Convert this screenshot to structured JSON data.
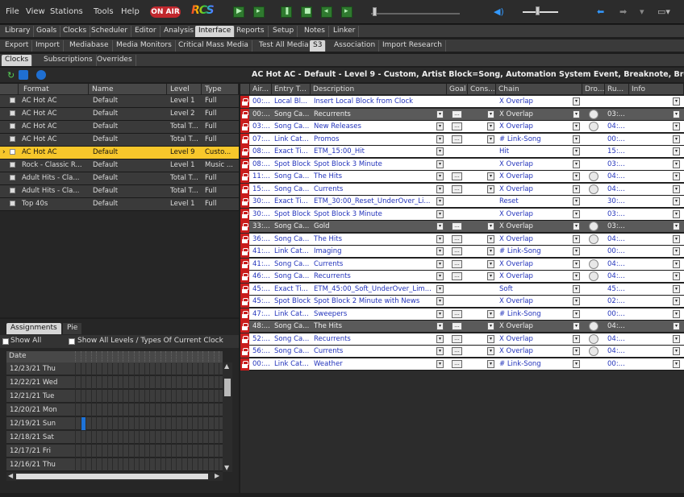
{
  "menu": {
    "items": [
      "File",
      "View",
      "Stations",
      "Tools",
      "Help"
    ],
    "on_air": "ON AIR",
    "logo": "RCS"
  },
  "tabs_row1": [
    "Library",
    "Goals",
    "Clocks",
    "Scheduler",
    "Editor",
    "Analysis",
    "Interface",
    "Reports",
    "Setup",
    "Notes",
    "Linker"
  ],
  "tabs_row1_active": "Interface",
  "tabs_row2": [
    "Export",
    "Import",
    "Mediabase",
    "Media Monitors",
    "Critical Mass Media",
    "Test All Media",
    "S3",
    "Association",
    "Import Research"
  ],
  "tabs_row2_active": "S3",
  "tabs_row3": [
    "Clocks",
    "Subscriptions",
    "Overrides"
  ],
  "tabs_row3_active": "Clocks",
  "clock_title": "AC Hot AC - Default - Level 9 - Custom, Artist Block=Song, Automation System Event, Breaknote, Browse List=Song, Contro",
  "left_grid": {
    "headers": [
      "Format",
      "Name",
      "Level",
      "Type"
    ],
    "rows": [
      {
        "format": "AC Hot AC",
        "name": "Default",
        "level": "Level 1",
        "type": "Full",
        "selected": false
      },
      {
        "format": "AC Hot AC",
        "name": "Default",
        "level": "Level 2",
        "type": "Full",
        "selected": false
      },
      {
        "format": "AC Hot AC",
        "name": "Default",
        "level": "Total T...",
        "type": "Full",
        "selected": false
      },
      {
        "format": "AC Hot AC",
        "name": "Default",
        "level": "Total T...",
        "type": "Full",
        "selected": false
      },
      {
        "format": "AC Hot AC",
        "name": "Default",
        "level": "Level 9",
        "type": "Custo...",
        "selected": true
      },
      {
        "format": "Rock - Classic R...",
        "name": "Default",
        "level": "Level 1",
        "type": "Music ...",
        "selected": false
      },
      {
        "format": "Adult Hits - Cla...",
        "name": "Default",
        "level": "Total T...",
        "type": "Full",
        "selected": false
      },
      {
        "format": "Adult Hits - Cla...",
        "name": "Default",
        "level": "Total T...",
        "type": "Full",
        "selected": false
      },
      {
        "format": "Top 40s",
        "name": "Default",
        "level": "Level 1",
        "type": "Full",
        "selected": false
      }
    ]
  },
  "right_grid": {
    "headers": [
      "Air...",
      "Entry T...",
      "Description",
      "Goal",
      "Cons...",
      "Chain",
      "Dro...",
      "Ru...",
      "Info"
    ],
    "rows": [
      {
        "air": "00:...",
        "entry": "Local Bl...",
        "desc": "Insert Local Block from Clock",
        "chain": "X Overlap",
        "run": "",
        "dark": false,
        "dd": false,
        "goal": false,
        "circle": false
      },
      {
        "air": "00:...",
        "entry": "Song Ca...",
        "desc": "Recurrents",
        "chain": "X Overlap",
        "run": "03:...",
        "dark": true,
        "dd": true,
        "goal": true,
        "circle": true
      },
      {
        "air": "03:...",
        "entry": "Song Ca...",
        "desc": "New Releases",
        "chain": "X Overlap",
        "run": "04:...",
        "dark": false,
        "dd": true,
        "goal": true,
        "circle": true
      },
      {
        "air": "07:...",
        "entry": "Link Cat...",
        "desc": "Promos",
        "chain": "# Link-Song",
        "run": "00:...",
        "dark": false,
        "dd": true,
        "goal": true,
        "circle": false
      },
      {
        "air": "08:...",
        "entry": "Exact Ti...",
        "desc": "ETM_15:00_Hit",
        "chain": "Hit",
        "run": "15:...",
        "dark": false,
        "dd": true,
        "goal": false,
        "circle": false
      },
      {
        "air": "08:...",
        "entry": "Spot Block",
        "desc": "Spot Block 3 Minute",
        "chain": "X Overlap",
        "run": "03:...",
        "dark": false,
        "dd": true,
        "goal": false,
        "circle": false
      },
      {
        "air": "11:...",
        "entry": "Song Ca...",
        "desc": "The Hits",
        "chain": "X Overlap",
        "run": "04:...",
        "dark": false,
        "dd": true,
        "goal": true,
        "circle": true
      },
      {
        "air": "15:...",
        "entry": "Song Ca...",
        "desc": "Currents",
        "chain": "X Overlap",
        "run": "04:...",
        "dark": false,
        "dd": true,
        "goal": true,
        "circle": true
      },
      {
        "air": "30:...",
        "entry": "Exact Ti...",
        "desc": "ETM_30:00_Reset_UnderOver_Li...",
        "chain": "Reset",
        "run": "30:...",
        "dark": false,
        "dd": true,
        "goal": false,
        "circle": false
      },
      {
        "air": "30:...",
        "entry": "Spot Block",
        "desc": "Spot Block 3 Minute",
        "chain": "X Overlap",
        "run": "03:...",
        "dark": false,
        "dd": true,
        "goal": false,
        "circle": false
      },
      {
        "air": "33:...",
        "entry": "Song Ca...",
        "desc": "Gold",
        "chain": "X Overlap",
        "run": "03:...",
        "dark": true,
        "dd": true,
        "goal": true,
        "circle": true
      },
      {
        "air": "36:...",
        "entry": "Song Ca...",
        "desc": "The Hits",
        "chain": "X Overlap",
        "run": "04:...",
        "dark": false,
        "dd": true,
        "goal": true,
        "circle": true
      },
      {
        "air": "41:...",
        "entry": "Link Cat...",
        "desc": "Imaging",
        "chain": "# Link-Song",
        "run": "00:...",
        "dark": false,
        "dd": true,
        "goal": true,
        "circle": false
      },
      {
        "air": "41:...",
        "entry": "Song Ca...",
        "desc": "Currents",
        "chain": "X Overlap",
        "run": "04:...",
        "dark": false,
        "dd": true,
        "goal": true,
        "circle": true
      },
      {
        "air": "46:...",
        "entry": "Song Ca...",
        "desc": "Recurrents",
        "chain": "X Overlap",
        "run": "04:...",
        "dark": false,
        "dd": true,
        "goal": true,
        "circle": true
      },
      {
        "air": "45:...",
        "entry": "Exact Ti...",
        "desc": "ETM_45:00_Soft_UnderOver_Lim...",
        "chain": "Soft",
        "run": "45:...",
        "dark": false,
        "dd": true,
        "goal": false,
        "circle": false
      },
      {
        "air": "45:...",
        "entry": "Spot Block",
        "desc": "Spot Block 2 Minute with News",
        "chain": "X Overlap",
        "run": "02:...",
        "dark": false,
        "dd": true,
        "goal": false,
        "circle": false
      },
      {
        "air": "47:...",
        "entry": "Link Cat...",
        "desc": "Sweepers",
        "chain": "# Link-Song",
        "run": "00:...",
        "dark": false,
        "dd": true,
        "goal": true,
        "circle": false
      },
      {
        "air": "48:...",
        "entry": "Song Ca...",
        "desc": "The Hits",
        "chain": "X Overlap",
        "run": "04:...",
        "dark": true,
        "dd": true,
        "goal": true,
        "circle": true
      },
      {
        "air": "52:...",
        "entry": "Song Ca...",
        "desc": "Recurrents",
        "chain": "X Overlap",
        "run": "04:...",
        "dark": false,
        "dd": true,
        "goal": true,
        "circle": true
      },
      {
        "air": "56:...",
        "entry": "Song Ca...",
        "desc": "Currents",
        "chain": "X Overlap",
        "run": "04:...",
        "dark": false,
        "dd": true,
        "goal": true,
        "circle": true
      },
      {
        "air": "00:...",
        "entry": "Link Cat...",
        "desc": "Weather",
        "chain": "# Link-Song",
        "run": "00:...",
        "dark": false,
        "dd": true,
        "goal": true,
        "circle": false
      }
    ]
  },
  "assignments": {
    "tabs": [
      "Assignments",
      "Pie"
    ],
    "show_all": "Show All",
    "show_all_levels": "Show All Levels / Types Of Current Clock",
    "date_header": "Date",
    "dates": [
      "12/23/21 Thu",
      "12/22/21 Wed",
      "12/21/21 Tue",
      "12/20/21 Mon",
      "12/19/21 Sun",
      "12/18/21 Sat",
      "12/17/21 Fri",
      "12/16/21 Thu"
    ]
  },
  "colors": {
    "selected_row": "#f7c72b",
    "lock": "#c91b1b",
    "link_text": "#2233bb",
    "assigned_cell": "#1e73d8"
  }
}
